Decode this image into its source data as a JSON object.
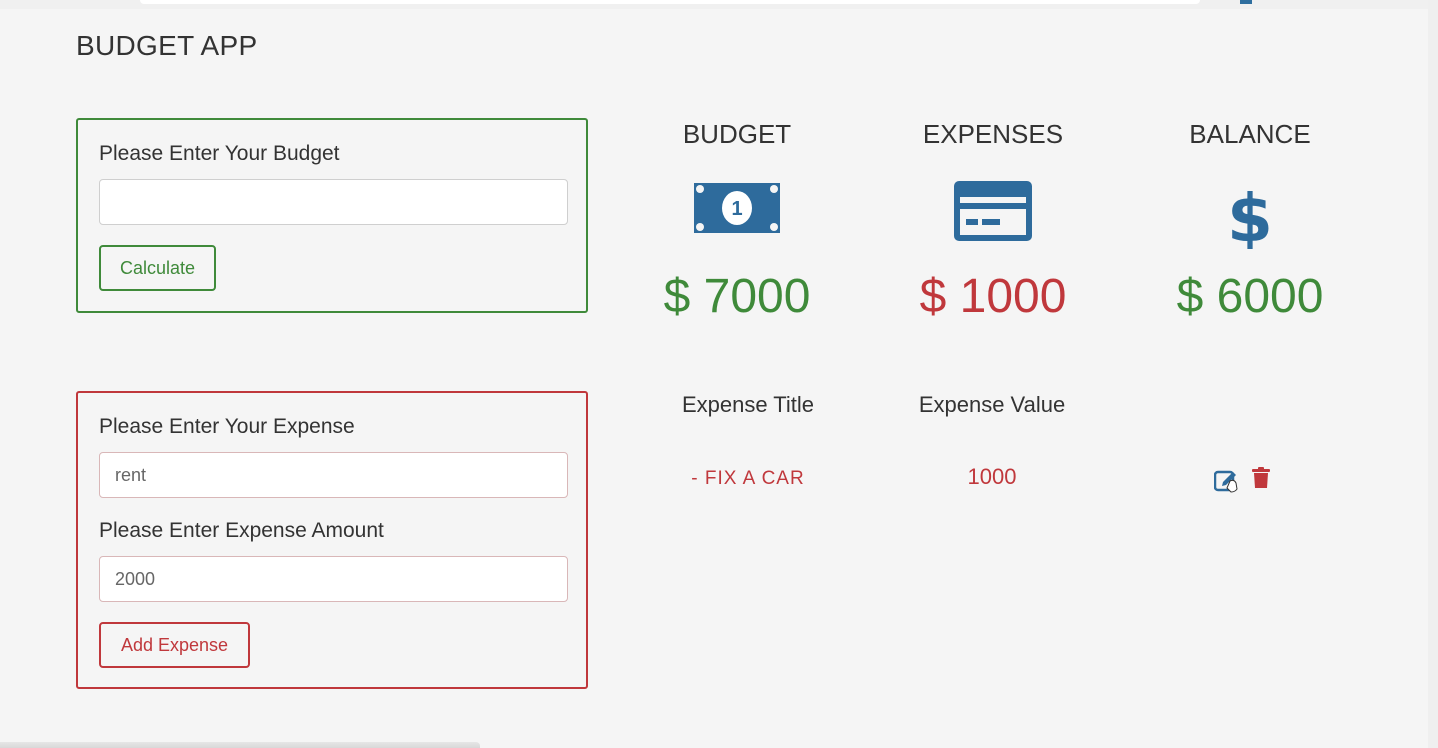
{
  "app": {
    "title": "BUDGET APP"
  },
  "budget_form": {
    "label": "Please Enter Your Budget",
    "input_value": "",
    "button_label": "Calculate"
  },
  "expense_form": {
    "title_label": "Please Enter Your Expense",
    "title_value": "rent",
    "amount_label": "Please Enter Expense Amount",
    "amount_value": "2000",
    "button_label": "Add Expense"
  },
  "summary": {
    "budget": {
      "label": "BUDGET",
      "amount": "$ 7000",
      "icon": "money-bill-icon",
      "color": "#3f8a3a"
    },
    "expenses": {
      "label": "EXPENSES",
      "amount": "$ 1000",
      "icon": "credit-card-icon",
      "color": "#c0383c"
    },
    "balance": {
      "label": "BALANCE",
      "amount": "$ 6000",
      "icon": "dollar-sign-icon",
      "color": "#3f8a3a"
    }
  },
  "expense_list": {
    "headers": {
      "title": "Expense Title",
      "value": "Expense Value"
    },
    "rows": [
      {
        "title": "- FIX A CAR",
        "value": "1000",
        "actions": [
          "edit-icon",
          "trash-icon"
        ]
      }
    ]
  },
  "colors": {
    "accent_blue": "#2e6b9c",
    "green": "#3f8a3a",
    "red": "#c0383c"
  }
}
